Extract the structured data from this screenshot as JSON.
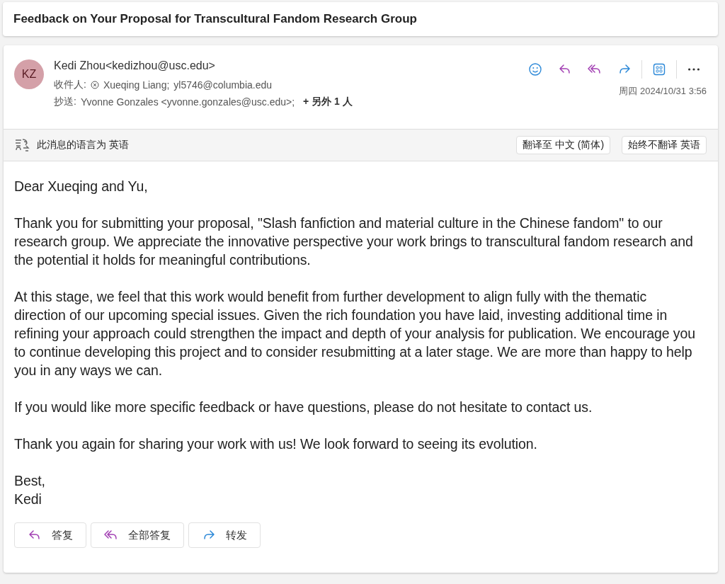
{
  "subject": "Feedback on Your Proposal for Transcultural Fandom Research Group",
  "sender": {
    "initials": "KZ",
    "color": "#d4a0a8",
    "name": "Kedi Zhou",
    "email": "<kedizhou@usc.edu>"
  },
  "to": {
    "label": "收件人:",
    "recipients": [
      "Xueqing Liang;",
      "yl5746@columbia.edu"
    ]
  },
  "cc": {
    "label": "抄送:",
    "recipients": [
      "Yvonne Gonzales <yvonne.gonzales@usc.edu>;"
    ],
    "more": "+ 另外 1 人"
  },
  "date": "周四 2024/10/31 3:56",
  "translation": {
    "message": "此消息的语言为 英语",
    "buttons": [
      "翻译至 中文 (简体)",
      "始终不翻译 英语"
    ]
  },
  "body": [
    "Dear Xueqing and Yu,",
    "Thank you for submitting your proposal, \"Slash fanfiction and material culture in the Chinese fandom\" to our research group. We appreciate the innovative perspective your work brings to transcultural fandom research and the potential it holds for meaningful contributions.",
    "At this stage, we feel that this work would benefit from further development to align fully with the thematic direction of our upcoming special issues. Given the rich foundation you have laid, investing additional time in refining your approach could strengthen the impact and depth of your analysis for publication. We encourage you to continue developing this project and to consider resubmitting at a later stage. We are more than happy to help you in any ways we can.",
    "If you would like more specific feedback or have questions, please do not hesitate to contact us.",
    "Thank you again for sharing your work with us! We look forward to seeing its evolution."
  ],
  "signature": [
    "Best,",
    "Kedi"
  ],
  "actions": [
    {
      "kind": "reply",
      "label": "答复"
    },
    {
      "kind": "reply_all",
      "label": "全部答复"
    },
    {
      "kind": "forward",
      "label": "转发"
    }
  ]
}
